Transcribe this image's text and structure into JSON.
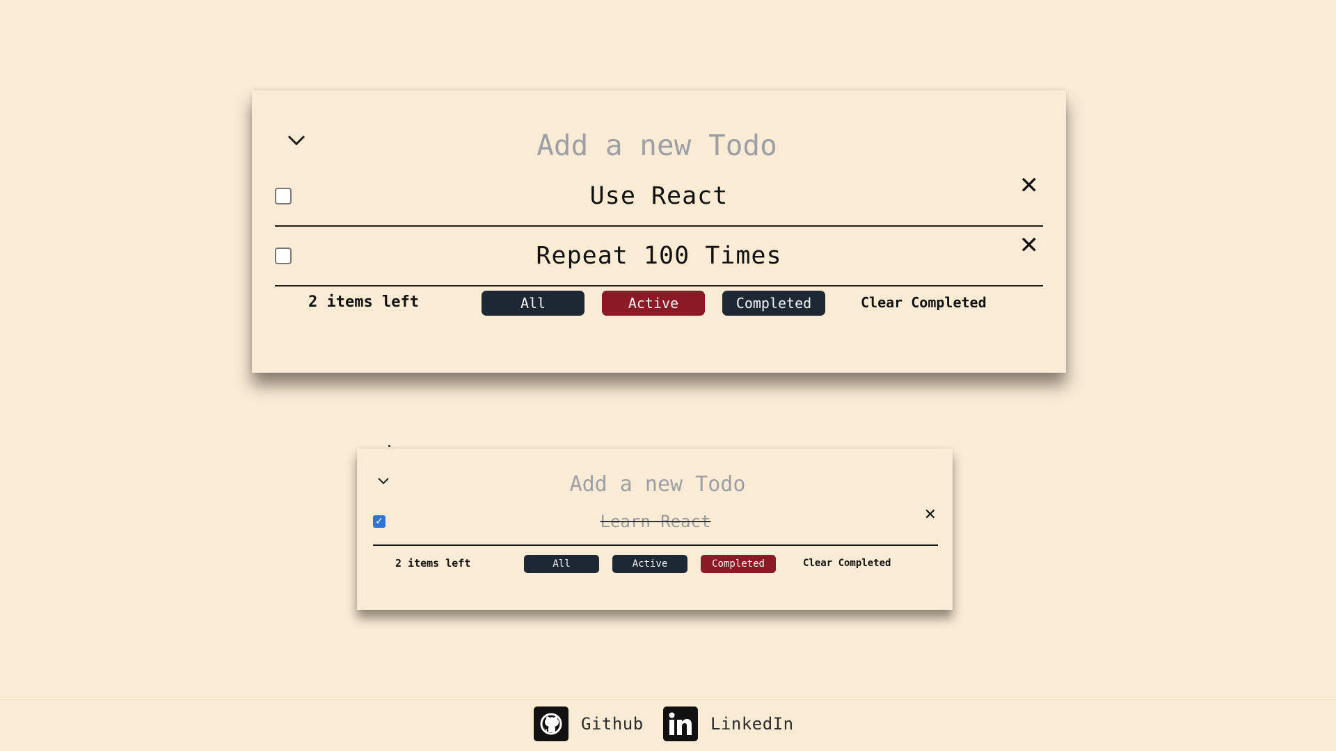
{
  "colors": {
    "background": "#faebd4",
    "button_dark": "#1e2835",
    "button_active": "#8b1a24",
    "placeholder": "#9d9fa6",
    "checkbox_checked": "#2d74d8"
  },
  "large_card": {
    "toggle_icon": "chevron-down-icon",
    "new_todo_placeholder": "Add a new Todo",
    "todos": [
      {
        "text": "Use React",
        "completed": false
      },
      {
        "text": "Repeat 100 Times",
        "completed": false
      }
    ],
    "footer": {
      "items_left": "2 items left",
      "filters": [
        {
          "label": "All",
          "selected": false
        },
        {
          "label": "Active",
          "selected": true
        },
        {
          "label": "Completed",
          "selected": false
        }
      ],
      "clear_label": "Clear Completed"
    }
  },
  "small_card": {
    "toggle_icon": "chevron-down-icon",
    "new_todo_placeholder": "Add a new Todo",
    "todos": [
      {
        "text": "Learn React",
        "completed": true
      }
    ],
    "footer": {
      "items_left": "2 items left",
      "filters": [
        {
          "label": "All",
          "selected": false
        },
        {
          "label": "Active",
          "selected": false
        },
        {
          "label": "Completed",
          "selected": true
        }
      ],
      "clear_label": "Clear Completed"
    }
  },
  "page_footer": {
    "links": [
      {
        "label": "Github",
        "icon": "github-icon"
      },
      {
        "label": "LinkedIn",
        "icon": "linkedin-icon"
      }
    ]
  }
}
